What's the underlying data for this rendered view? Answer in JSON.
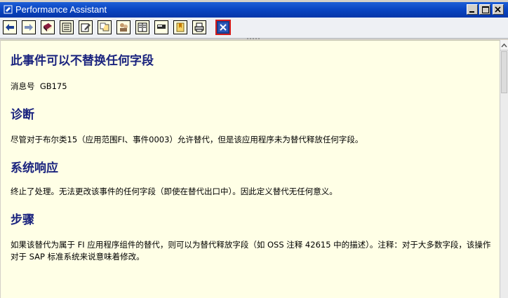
{
  "window": {
    "title": "Performance Assistant",
    "controls": [
      "minimize",
      "maximize",
      "close"
    ]
  },
  "toolbar": {
    "buttons": [
      {
        "icon": "back-arrow-icon"
      },
      {
        "icon": "forward-arrow-icon"
      },
      {
        "icon": "book-icon"
      },
      {
        "icon": "technical-info-icon"
      },
      {
        "icon": "edit-icon"
      },
      {
        "icon": "glossary-icon"
      },
      {
        "icon": "users-icon"
      },
      {
        "icon": "document-icon"
      },
      {
        "icon": "keyboard-icon"
      },
      {
        "icon": "bookmark-icon"
      },
      {
        "icon": "print-icon"
      },
      {
        "icon": "close-window-icon",
        "active": true
      }
    ],
    "colors": {
      "active_border": "#d21b1b",
      "active_fill": "#1a3c8c"
    }
  },
  "document": {
    "title": "此事件可以不替换任何字段",
    "message_label": "消息号",
    "message_id": "GB175",
    "sections": [
      {
        "heading": "诊断",
        "text": "尽管对于布尔类15（应用范围FI、事件0003）允许替代，但是该应用程序未为替代释放任何字段。"
      },
      {
        "heading": "系统响应",
        "text": "终止了处理。无法更改该事件的任何字段（即使在替代出口中）。因此定义替代无任何意义。"
      },
      {
        "heading": "步骤",
        "text": "如果该替代为属于 FI 应用程序组件的替代，则可以为替代释放字段（如 OSS 注释 42615 中的描述）。注释：对于大多数字段，该操作对于 SAP 标准系统来说意味着修改。"
      }
    ],
    "colors": {
      "background": "#ffffe6",
      "heading": "#1a237e"
    }
  }
}
